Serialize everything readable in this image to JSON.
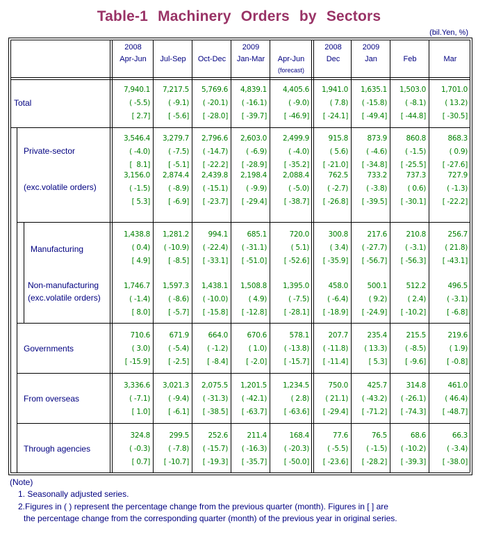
{
  "title": "Table-1  Machinery  Orders  by  Sectors",
  "unit": "(bil.Yen, %)",
  "columns": [
    {
      "year": "2008",
      "period": "Apr-Jun",
      "sub": ""
    },
    {
      "year": "",
      "period": "Jul-Sep",
      "sub": ""
    },
    {
      "year": "",
      "period": "Oct-Dec",
      "sub": ""
    },
    {
      "year": "2009",
      "period": "Jan-Mar",
      "sub": ""
    },
    {
      "year": "",
      "period": "Apr-Jun",
      "sub": "(forecast)"
    },
    {
      "year": "2008",
      "period": "Dec",
      "sub": ""
    },
    {
      "year": "2009",
      "period": "Jan",
      "sub": ""
    },
    {
      "year": "",
      "period": "Feb",
      "sub": ""
    },
    {
      "year": "",
      "period": "Mar",
      "sub": ""
    }
  ],
  "rows": [
    {
      "label": "Total",
      "value": [
        "7,940.1",
        "7,217.5",
        "5,769.6",
        "4,839.1",
        "4,405.6",
        "1,941.0",
        "1,635.1",
        "1,503.0",
        "1,701.0"
      ],
      "qoq": [
        "( -5.5)",
        "( -9.1)",
        "( -20.1)",
        "( -16.1)",
        "( -9.0)",
        "( 7.8)",
        "( -15.8)",
        "( -8.1)",
        "( 13.2)"
      ],
      "yoy": [
        "[ 2.7]",
        "[ -5.6]",
        "[ -28.0]",
        "[ -39.7]",
        "[ -46.9]",
        "[ -24.1]",
        "[ -49.4]",
        "[ -44.8]",
        "[ -30.5]"
      ]
    },
    {
      "label": "Private-sector",
      "value": [
        "3,546.4",
        "3,279.7",
        "2,796.6",
        "2,603.0",
        "2,499.9",
        "915.8",
        "873.9",
        "860.8",
        "868.3"
      ],
      "qoq": [
        "( -4.0)",
        "( -7.5)",
        "( -14.7)",
        "( -6.9)",
        "( -4.0)",
        "( 5.6)",
        "( -4.6)",
        "( -1.5)",
        "( 0.9)"
      ],
      "yoy": [
        "[  8.1]",
        "[ -5.1]",
        "[ -22.2]",
        "[ -28.9]",
        "[ -35.2]",
        "[ -21.0]",
        "[ -34.8]",
        "[ -25.5]",
        "[ -27.6]"
      ]
    },
    {
      "label": "(exc.volatile orders)",
      "value": [
        "3,156.0",
        "2,874.4",
        "2,439.8",
        "2,198.4",
        "2,088.4",
        "762.5",
        "733.2",
        "737.3",
        "727.9"
      ],
      "qoq": [
        "( -1.5)",
        "( -8.9)",
        "( -15.1)",
        "( -9.9)",
        "( -5.0)",
        "( -2.7)",
        "( -3.8)",
        "( 0.6)",
        "( -1.3)"
      ],
      "yoy": [
        "[ 5.3]",
        "[ -6.9]",
        "[ -23.7]",
        "[ -29.4]",
        "[ -38.7]",
        "[ -26.8]",
        "[ -39.5]",
        "[ -30.1]",
        "[ -22.2]"
      ]
    },
    {
      "label": "Manufacturing",
      "value": [
        "1,438.8",
        "1,281.2",
        "994.1",
        "685.1",
        "720.0",
        "300.8",
        "217.6",
        "210.8",
        "256.7"
      ],
      "qoq": [
        "( 0.4)",
        "( -10.9)",
        "( -22.4)",
        "( -31.1)",
        "( 5.1)",
        "( 3.4)",
        "( -27.7)",
        "( -3.1)",
        "( 21.8)"
      ],
      "yoy": [
        "[ 4.9]",
        "[ -8.5]",
        "[ -33.1]",
        "[ -51.0]",
        "[ -52.6]",
        "[ -35.9]",
        "[ -56.7]",
        "[ -56.3]",
        "[ -43.1]"
      ]
    },
    {
      "label": "Non-manufacturing",
      "label2": "(exc.volatile orders)",
      "value": [
        "1,746.7",
        "1,597.3",
        "1,438.1",
        "1,508.8",
        "1,395.0",
        "458.0",
        "500.1",
        "512.2",
        "496.5"
      ],
      "qoq": [
        "( -1.4)",
        "( -8.6)",
        "( -10.0)",
        "( 4.9)",
        "( -7.5)",
        "( -6.4)",
        "( 9.2)",
        "( 2.4)",
        "( -3.1)"
      ],
      "yoy": [
        "[ 8.0]",
        "[ -5.7]",
        "[ -15.8]",
        "[ -12.8]",
        "[ -28.1]",
        "[ -18.9]",
        "[ -24.9]",
        "[ -10.2]",
        "[ -6.8]"
      ]
    },
    {
      "label": "Governments",
      "value": [
        "710.6",
        "671.9",
        "664.0",
        "670.6",
        "578.1",
        "207.7",
        "235.4",
        "215.5",
        "219.6"
      ],
      "qoq": [
        "( 3.0)",
        "( -5.4)",
        "( -1.2)",
        "( 1.0)",
        "( -13.8)",
        "( -11.8)",
        "( 13.3)",
        "( -8.5)",
        "( 1.9)"
      ],
      "yoy": [
        "[ -15.9]",
        "[ -2.5]",
        "[ -8.4]",
        "[ -2.0]",
        "[ -15.7]",
        "[ -11.4]",
        "[ 5.3]",
        "[ -9.6]",
        "[ -0.8]"
      ]
    },
    {
      "label": "From overseas",
      "value": [
        "3,336.6",
        "3,021.3",
        "2,075.5",
        "1,201.5",
        "1,234.5",
        "750.0",
        "425.7",
        "314.8",
        "461.0"
      ],
      "qoq": [
        "( -7.1)",
        "( -9.4)",
        "( -31.3)",
        "( -42.1)",
        "( 2.8)",
        "( 21.1)",
        "( -43.2)",
        "( -26.1)",
        "( 46.4)"
      ],
      "yoy": [
        "[ 1.0]",
        "[ -6.1]",
        "[ -38.5]",
        "[ -63.7]",
        "[ -63.6]",
        "[ -29.4]",
        "[ -71.2]",
        "[ -74.3]",
        "[ -48.7]"
      ]
    },
    {
      "label": "Through agencies",
      "value": [
        "324.8",
        "299.5",
        "252.6",
        "211.4",
        "168.4",
        "77.6",
        "76.5",
        "68.6",
        "66.3"
      ],
      "qoq": [
        "( -0.3)",
        "( -7.8)",
        "( -15.7)",
        "( -16.3)",
        "( -20.3)",
        "( -5.5)",
        "( -1.5)",
        "( -10.2)",
        "( -3.4)"
      ],
      "yoy": [
        "[ 0.7]",
        "[ -10.7]",
        "[ -19.3]",
        "[ -35.7]",
        "[ -50.0]",
        "[ -23.6]",
        "[ -28.2]",
        "[ -39.3]",
        "[ -38.0]"
      ]
    }
  ],
  "notes": {
    "heading": "(Note)",
    "line1": "1. Seasonally adjusted series.",
    "line2": "2.Figures in ( ) represent the percentage change from the previous quarter (month). Figures in [ ] are",
    "line3": "the percentage change from the corresponding quarter (month) of the previous year in original series."
  },
  "colors": {
    "title": "#993366",
    "label": "#000080",
    "value": "#008000"
  }
}
